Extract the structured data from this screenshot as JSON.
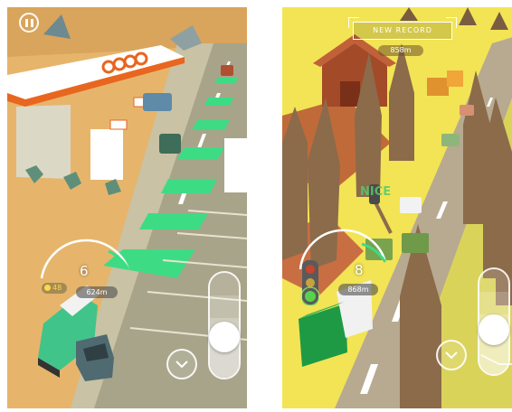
{
  "left_screen": {
    "pause": {
      "icon": "pause-icon"
    },
    "station_sign": "coop",
    "speedometer": {
      "speed": "6",
      "coins": "48",
      "distance": "624m"
    },
    "down_button": {
      "icon": "chevron-down-icon"
    },
    "throttle": {
      "knob_level": 0.5
    },
    "colors": {
      "road": "#a9a58a",
      "lane_arrows": "#3ddc84",
      "ground": "#e7b86a",
      "canopy": "#ffffff",
      "brand": "#e8661f"
    }
  },
  "right_screen": {
    "banner": {
      "title": "NEW RECORD",
      "distance": "858m"
    },
    "nice_text": "NICE",
    "speedometer": {
      "speed": "8",
      "distance": "868m"
    },
    "down_button": {
      "icon": "chevron-down-icon"
    },
    "throttle": {
      "knob_level": 0.5
    },
    "traffic_light": {
      "state": "green",
      "icon": "traffic-light-icon"
    },
    "colors": {
      "ground": "#f5e85c",
      "road": "#b9aa93",
      "trees": "#8a6a4a",
      "truck": "#27a24a"
    }
  }
}
